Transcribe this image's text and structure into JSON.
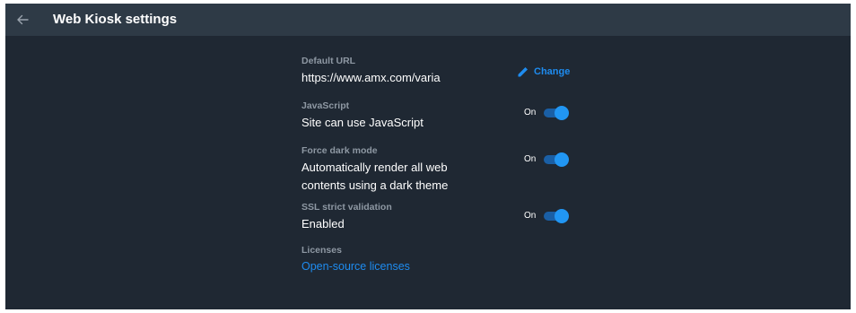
{
  "header": {
    "title": "Web Kiosk settings",
    "back_icon": "arrow-left-icon"
  },
  "settings": {
    "default_url": {
      "label": "Default URL",
      "value": "https://www.amx.com/varia",
      "action_label": "Change",
      "action_icon": "pencil-icon"
    },
    "javascript": {
      "label": "JavaScript",
      "value": "Site can use JavaScript",
      "toggle_label": "On",
      "enabled": true
    },
    "force_dark_mode": {
      "label": "Force dark mode",
      "value_line1": "Automatically render all web",
      "value_line2": "contents using a dark theme",
      "toggle_label": "On",
      "enabled": true
    },
    "ssl_strict_validation": {
      "label": "SSL strict validation",
      "value": "Enabled",
      "toggle_label": "On",
      "enabled": true
    },
    "licenses": {
      "label": "Licenses",
      "link": "Open-source licenses"
    }
  },
  "colors": {
    "background": "#1f2833",
    "app_bar": "#2e3a46",
    "accent": "#2196f3",
    "link": "#1e8cf0",
    "secondary_text": "#8e98a3"
  }
}
